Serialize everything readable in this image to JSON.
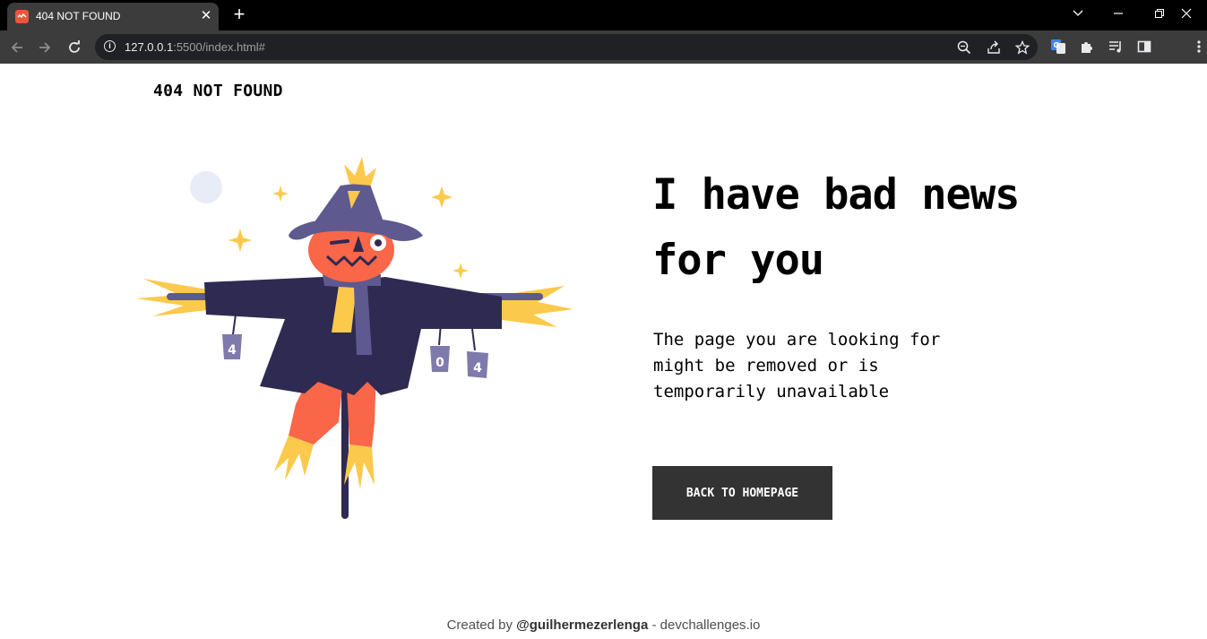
{
  "browser": {
    "tab": {
      "title": "404 NOT FOUND"
    },
    "address_bar": {
      "host": "127.0.0.1",
      "path": ":5500/index.html#"
    }
  },
  "page": {
    "logo": "404 NOT FOUND",
    "headline": "I have bad news for you",
    "subtext": "The page you are looking for might be removed or is temporarily unavailable",
    "button_label": "BACK TO HOMEPAGE",
    "illustration": {
      "can_labels": [
        "4",
        "0",
        "4"
      ]
    },
    "footer": {
      "prefix": "Created by ",
      "author": "@guilhermezerlenga",
      "suffix": " - devchallenges.io"
    }
  },
  "colors": {
    "button_bg": "#333333",
    "scarecrow_hat": "#5e5a8f",
    "scarecrow_coat": "#2e2a52",
    "scarecrow_face": "#fa6648",
    "straw": "#fbc94b"
  }
}
